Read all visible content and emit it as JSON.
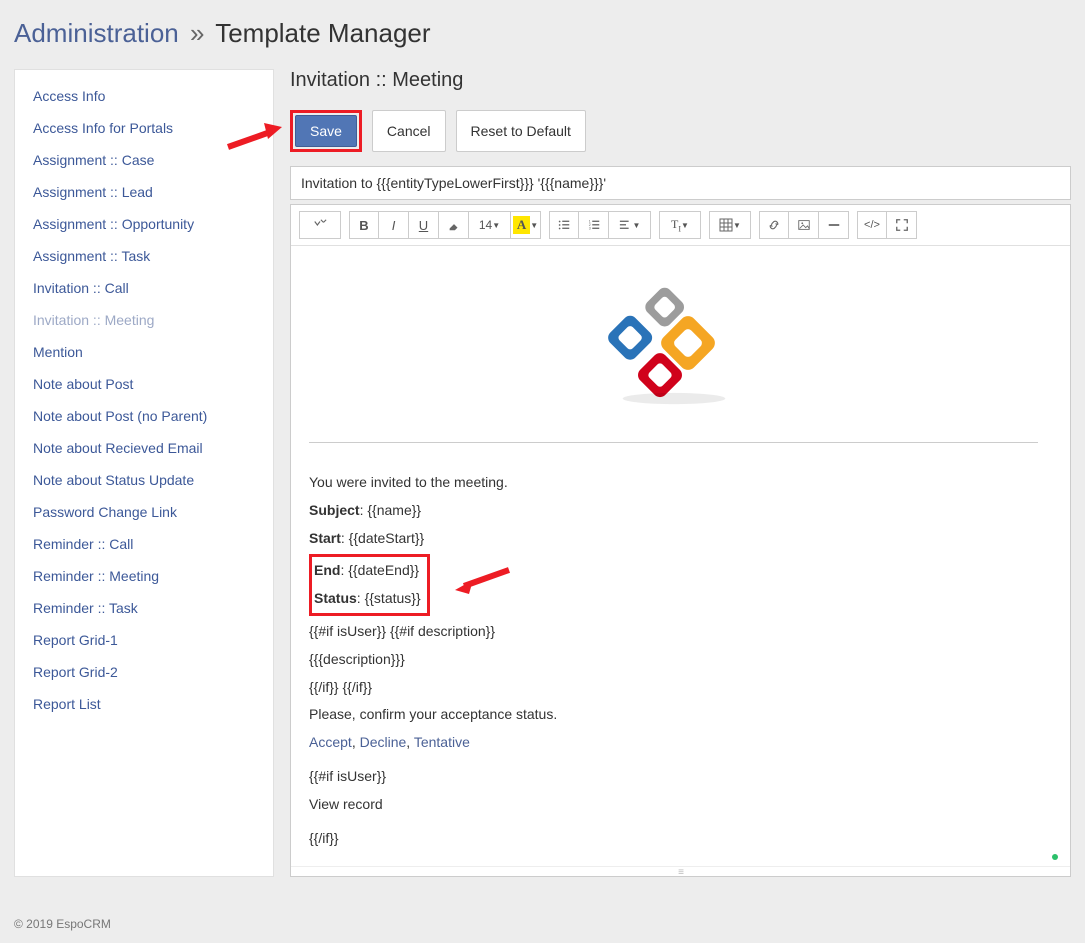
{
  "header": {
    "admin_link": "Administration",
    "separator": "»",
    "title": "Template Manager"
  },
  "sidebar": {
    "items": [
      {
        "label": "Access Info",
        "active": false
      },
      {
        "label": "Access Info for Portals",
        "active": false
      },
      {
        "label": "Assignment :: Case",
        "active": false
      },
      {
        "label": "Assignment :: Lead",
        "active": false
      },
      {
        "label": "Assignment :: Opportunity",
        "active": false
      },
      {
        "label": "Assignment :: Task",
        "active": false
      },
      {
        "label": "Invitation :: Call",
        "active": false
      },
      {
        "label": "Invitation :: Meeting",
        "active": true
      },
      {
        "label": "Mention",
        "active": false
      },
      {
        "label": "Note about Post",
        "active": false
      },
      {
        "label": "Note about Post (no Parent)",
        "active": false
      },
      {
        "label": "Note about Recieved Email",
        "active": false
      },
      {
        "label": "Note about Status Update",
        "active": false
      },
      {
        "label": "Password Change Link",
        "active": false
      },
      {
        "label": "Reminder :: Call",
        "active": false
      },
      {
        "label": "Reminder :: Meeting",
        "active": false
      },
      {
        "label": "Reminder :: Task",
        "active": false
      },
      {
        "label": "Report Grid-1",
        "active": false
      },
      {
        "label": "Report Grid-2",
        "active": false
      },
      {
        "label": "Report List",
        "active": false
      }
    ]
  },
  "main": {
    "title": "Invitation :: Meeting",
    "buttons": {
      "save": "Save",
      "cancel": "Cancel",
      "reset": "Reset to Default"
    },
    "subject": "Invitation to {{{entityTypeLowerFirst}}} '{{{name}}}'",
    "toolbar": {
      "fontsize": "14"
    },
    "body": {
      "intro": "You were invited to the meeting.",
      "subject_label": "Subject",
      "subject_val": ": {{name}}",
      "start_label": "Start",
      "start_val": ": {{dateStart}}",
      "end_label": "End",
      "end_val": ": {{dateEnd}}",
      "status_label": "Status",
      "status_val": ": {{status}}",
      "cond1": "{{#if isUser}} {{#if description}}",
      "desc": "{{{description}}}",
      "cond2": "{{/if}} {{/if}}",
      "confirm": "Please, confirm your acceptance status.",
      "accept": "Accept",
      "decline": "Decline",
      "tentative": "Tentative",
      "comma": ", ",
      "cond3": "{{#if isUser}}",
      "view_record": "View record",
      "cond4": "{{/if}}"
    }
  },
  "footer": {
    "copyright": "© 2019 EspoCRM"
  }
}
